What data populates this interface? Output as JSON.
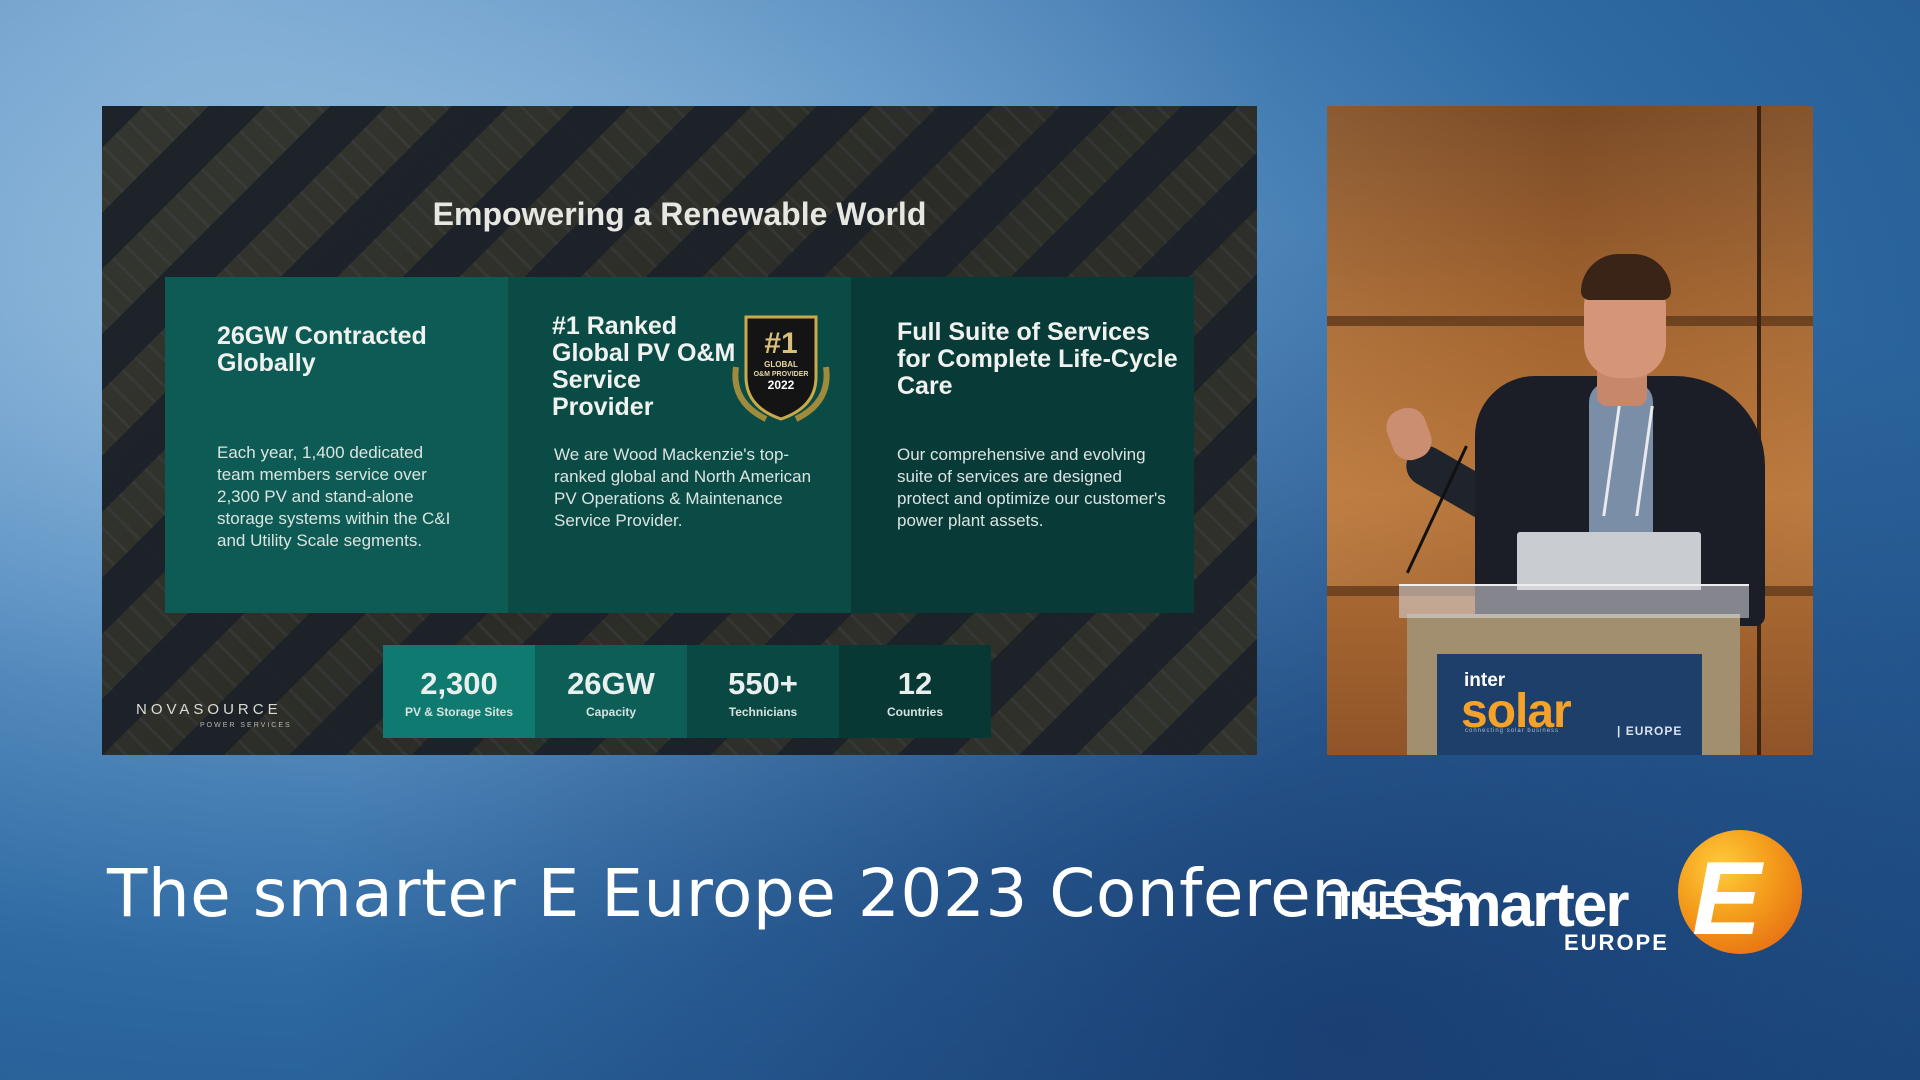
{
  "slide": {
    "title": "Empowering a Renewable World",
    "panels": [
      {
        "heading": "26GW Contracted Globally",
        "body": "Each year, 1,400 dedicated team members service over 2,300 PV and stand-alone storage systems within the C&I and Utility Scale segments."
      },
      {
        "heading": "#1 Ranked Global PV O&M Service Provider",
        "body": "We are Wood Mackenzie's top-ranked global and North American PV Operations & Maintenance Service Provider.",
        "badge": {
          "rank": "#1",
          "line1": "GLOBAL",
          "line2": "O&M PROVIDER",
          "year": "2022"
        }
      },
      {
        "heading": "Full Suite of Services for Complete Life-Cycle Care",
        "body": "Our comprehensive and evolving suite of services are designed protect and optimize our customer's power plant assets."
      }
    ],
    "stats": [
      {
        "value": "2,300",
        "label": "PV & Storage Sites"
      },
      {
        "value": "26GW",
        "label": "Capacity"
      },
      {
        "value": "550+",
        "label": "Technicians"
      },
      {
        "value": "12",
        "label": "Countries"
      }
    ],
    "logo": {
      "name": "NOVASOURCE",
      "sub": "POWER SERVICES"
    }
  },
  "speaker_feed": {
    "podium": {
      "inter": "inter",
      "solar": "solar",
      "tagline": "connecting solar business",
      "europe": "| EUROPE"
    }
  },
  "footer": {
    "conference_title": "The smarter E Europe 2023 Conferences",
    "brand": {
      "the": "THE",
      "smarter": "smarter",
      "letter": "E",
      "europe": "EUROPE"
    }
  },
  "colors": {
    "panel_teal_1": "#0d5b54",
    "panel_teal_2": "#0b4b46",
    "panel_teal_3": "#083a37",
    "brand_orange": "#f39a1a",
    "solar_orange": "#f5a22a"
  }
}
